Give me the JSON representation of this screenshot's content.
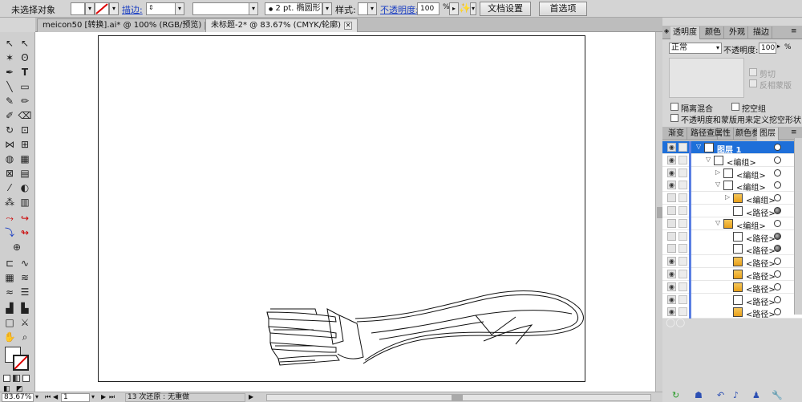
{
  "control_bar": {
    "selection_status": "未选择对象",
    "stroke_label": "描边:",
    "brush_size": "2 pt.",
    "brush_shape": "椭圆形",
    "style_label": "样式:",
    "opacity_label": "不透明度:",
    "opacity_value": "100",
    "opacity_unit": "%",
    "doc_setup_button": "文档设置",
    "preferences_button": "首选项"
  },
  "doc_tabs": [
    {
      "label": "meicon50 [转换].ai* @ 100% (RGB/预览)"
    },
    {
      "label": "未标题-2* @ 83.67% (CMYK/轮廓)"
    }
  ],
  "status_bar": {
    "zoom": "83.67%",
    "page": "1",
    "status_text": "13 次还原 : 无重做"
  },
  "transparency_panel": {
    "tabs": [
      "透明度",
      "颜色",
      "外观",
      "描边"
    ],
    "blend_mode": "正常",
    "opacity_label": "不透明度:",
    "opacity_value": "100",
    "opacity_unit": "%",
    "clip_label": "剪切",
    "invert_mask_label": "反相蒙版",
    "isolate_blend_label": "隔离混合",
    "knockout_group_label": "挖空组",
    "define_knockout_label": "不透明度和蒙版用来定义挖空形状"
  },
  "layers_panel": {
    "tabs": [
      "渐变",
      "路径查",
      "属性",
      "颜色参",
      "图层"
    ],
    "rows": [
      {
        "name": "图层 1",
        "indent": 0,
        "twirl": "▽",
        "target_filled": false,
        "selected": true
      },
      {
        "name": "<编组>",
        "indent": 1,
        "twirl": "▽",
        "target_filled": false
      },
      {
        "name": "<编组>",
        "indent": 2,
        "twirl": "▷",
        "target_filled": false
      },
      {
        "name": "<编组>",
        "indent": 2,
        "twirl": "▽",
        "target_filled": false
      },
      {
        "name": "<编组>",
        "indent": 3,
        "twirl": "▷",
        "target_filled": false
      },
      {
        "name": "<路径>",
        "indent": 3,
        "twirl": "",
        "target_filled": true
      },
      {
        "name": "<编组>",
        "indent": 2,
        "twirl": "▽",
        "target_filled": false
      },
      {
        "name": "<路径>",
        "indent": 3,
        "twirl": "",
        "target_filled": true
      },
      {
        "name": "<路径>",
        "indent": 3,
        "twirl": "",
        "target_filled": true
      },
      {
        "name": "<路径>",
        "indent": 3,
        "twirl": "",
        "target_filled": false
      },
      {
        "name": "<路径>",
        "indent": 3,
        "twirl": "",
        "target_filled": false
      },
      {
        "name": "<路径>",
        "indent": 3,
        "twirl": "",
        "target_filled": false
      },
      {
        "name": "<路径>",
        "indent": 3,
        "twirl": "",
        "target_filled": false
      },
      {
        "name": "<路径>",
        "indent": 3,
        "twirl": "",
        "target_filled": false
      }
    ]
  },
  "colors": {
    "selection_blue": "#1e6fd9",
    "layer_color_bar": "#5a7fe3",
    "link_blue": "#1a3ec2"
  }
}
